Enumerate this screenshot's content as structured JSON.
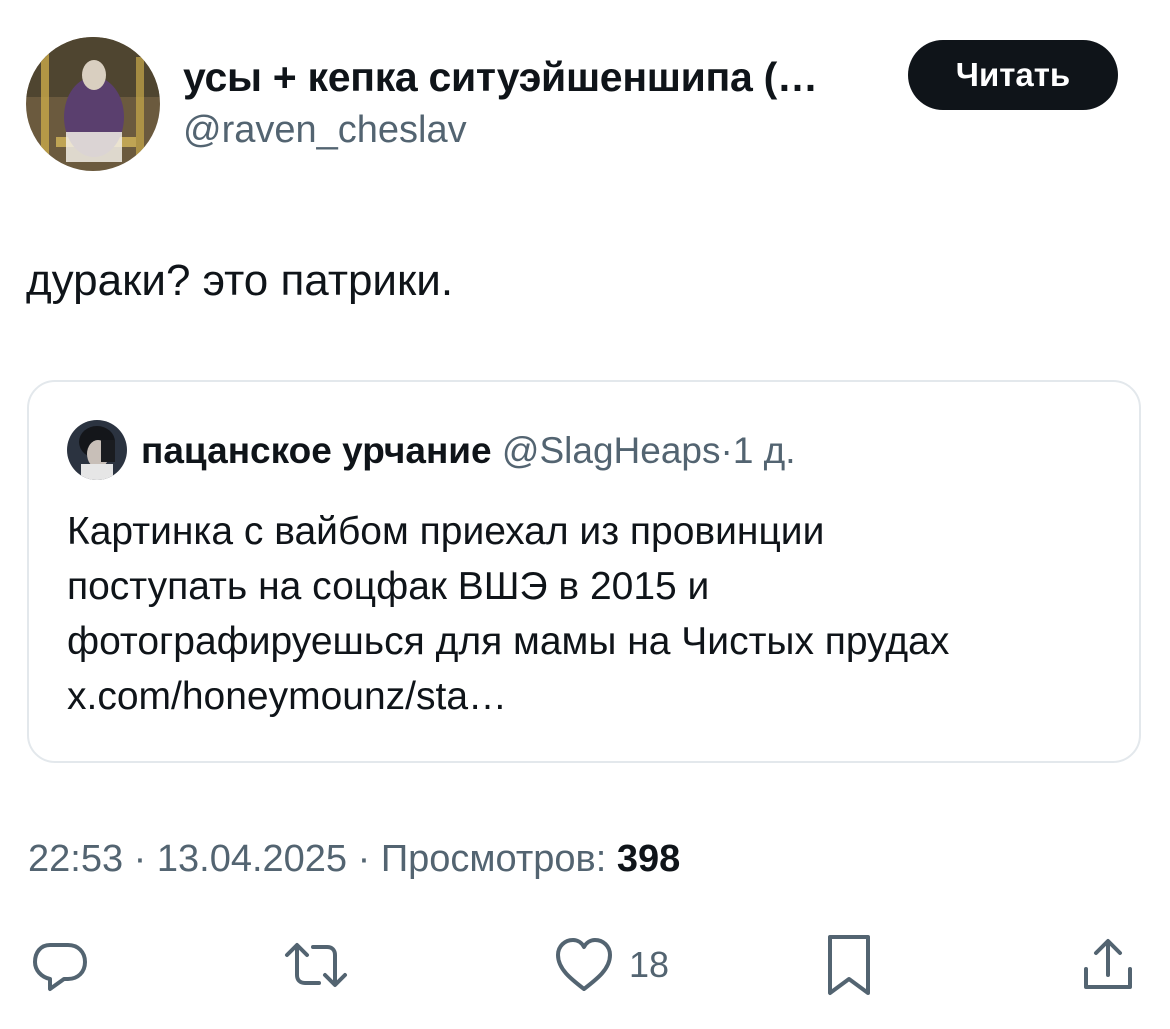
{
  "author": {
    "display_name": "усы + кепка ситуэйшеншипа (…",
    "handle": "@raven_cheslav"
  },
  "follow_button": {
    "label": "Читать"
  },
  "tweet": {
    "text": "дураки? это патрики."
  },
  "quote": {
    "author_name": "пацанское урчание",
    "author_handle": "@SlagHeaps",
    "separator": "·",
    "time": "1 д.",
    "text_lines": [
      "Картинка с вайбом приехал из провинции",
      "поступать на соцфак ВШЭ в 2015 и",
      "фотографируешься для мамы на Чистых прудах",
      "x.com/honeymounz/sta…"
    ]
  },
  "meta": {
    "time": "22:53",
    "date": "13.04.2025",
    "separator": "·",
    "views_label": "Просмотров:",
    "views_count": "398"
  },
  "actions": {
    "reply_icon": "reply-icon",
    "retweet_icon": "retweet-icon",
    "like_icon": "heart-icon",
    "like_count": "18",
    "bookmark_icon": "bookmark-icon",
    "share_icon": "share-icon"
  },
  "colors": {
    "text_primary": "#0f1419",
    "text_secondary": "#536471",
    "border": "#e3e8ec",
    "button_bg": "#0f1419"
  }
}
